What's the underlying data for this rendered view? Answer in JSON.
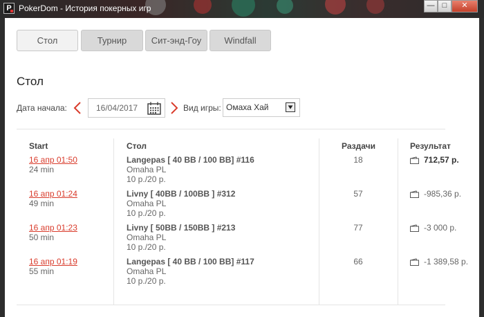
{
  "window": {
    "title": "PokerDom - История покерных игр",
    "icon_letter": "P",
    "controls": [
      "—",
      "□",
      "✕"
    ]
  },
  "tabs": [
    {
      "label": "Стол",
      "active": true
    },
    {
      "label": "Турнир",
      "active": false
    },
    {
      "label": "Сит-энд-Гоу",
      "active": false
    },
    {
      "label": "Windfall",
      "active": false
    }
  ],
  "section": {
    "title": "Стол"
  },
  "filters": {
    "start_date_label": "Дата начала:",
    "start_date_value": "16/04/2017",
    "game_type_label": "Вид игры:",
    "game_type_value": "Омаха Хай"
  },
  "table": {
    "headers": {
      "start": "Start",
      "table": "Стол",
      "hands": "Раздачи",
      "result": "Результат"
    },
    "rows": [
      {
        "start": "16 апр 01:50",
        "duration": "24 min",
        "name": "Langepas [ 40 BB / 100 BB] #116",
        "game": "Omaha PL",
        "stakes": "10 р./20 р.",
        "hands": "18",
        "result": "712,57 р.",
        "win": true
      },
      {
        "start": "16 апр 01:24",
        "duration": "49 min",
        "name": "Livny [ 40BB / 100BB ] #312",
        "game": "Omaha PL",
        "stakes": "10 р./20 р.",
        "hands": "57",
        "result": "-985,36 р.",
        "win": false
      },
      {
        "start": "16 апр 01:23",
        "duration": "50 min",
        "name": "Livny [ 50BB / 150BB ] #213",
        "game": "Omaha PL",
        "stakes": "10 р./20 р.",
        "hands": "77",
        "result": "-3 000 р.",
        "win": false
      },
      {
        "start": "16 апр 01:19",
        "duration": "55 min",
        "name": "Langepas [ 40 BB / 100 BB] #117",
        "game": "Omaha PL",
        "stakes": "10 р./20 р.",
        "hands": "66",
        "result": "-1 389,58 р.",
        "win": false
      }
    ]
  },
  "colors": {
    "accent_red": "#d93b2b",
    "tab_bg": "#d9d9d9"
  }
}
